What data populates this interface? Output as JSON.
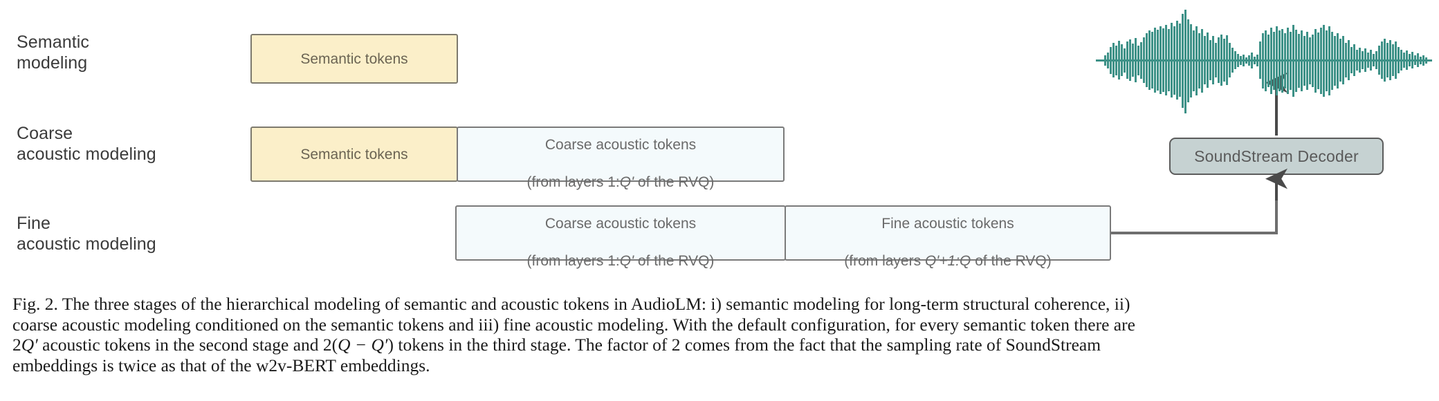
{
  "figure": {
    "rows": [
      {
        "id": "semantic-modeling",
        "label": "Semantic\nmodeling",
        "boxes": [
          {
            "id": "semantic-tokens",
            "kind": "semantic",
            "text": "Semantic tokens"
          }
        ]
      },
      {
        "id": "coarse-acoustic-modeling",
        "label": "Coarse\nacoustic modeling",
        "boxes": [
          {
            "id": "semantic-tokens",
            "kind": "semantic",
            "text": "Semantic tokens"
          },
          {
            "id": "coarse-acoustic-tokens",
            "kind": "acoustic",
            "line1": "Coarse acoustic tokens",
            "line2_pre": "(from layers 1:",
            "line2_italic": "Q'",
            "line2_post": " of the RVQ)"
          }
        ]
      },
      {
        "id": "fine-acoustic-modeling",
        "label": "Fine\nacoustic modeling",
        "boxes": [
          {
            "id": "coarse-acoustic-tokens",
            "kind": "acoustic",
            "line1": "Coarse acoustic tokens",
            "line2_pre": "(from layers 1:",
            "line2_italic": "Q'",
            "line2_post": " of the RVQ)"
          },
          {
            "id": "fine-acoustic-tokens",
            "kind": "acoustic",
            "line1": "Fine acoustic tokens",
            "line2_pre": "(from layers ",
            "line2_italic": "Q'+1:Q",
            "line2_post": " of the RVQ)"
          }
        ]
      }
    ],
    "decoder": {
      "label": "SoundStream Decoder"
    },
    "waveform": {
      "name": "audio-waveform",
      "color": "#3d9187"
    },
    "colors": {
      "semantic_fill": "#fbefc9",
      "acoustic_fill": "#f4fafc",
      "decoder_fill": "#c6d2d2",
      "stroke": "#6d6a60",
      "waveform": "#3d9187"
    }
  },
  "caption": {
    "line1": "Fig. 2.  The three stages of the hierarchical modeling of semantic and acoustic tokens in AudioLM: i) semantic modeling for long-term structural coherence, ii)",
    "line2": "coarse acoustic modeling conditioned on the semantic tokens and iii) fine acoustic modeling. With the default configuration, for every semantic token there are",
    "line3_a": "2",
    "line3_b": "Q′",
    "line3_c": " acoustic tokens in the second stage and 2(",
    "line3_d": "Q − Q′",
    "line3_e": ") tokens in the third stage. The factor of 2 comes from the fact that the sampling rate of SoundStream",
    "line4": "embeddings is twice as that of the w2v-BERT embeddings."
  }
}
